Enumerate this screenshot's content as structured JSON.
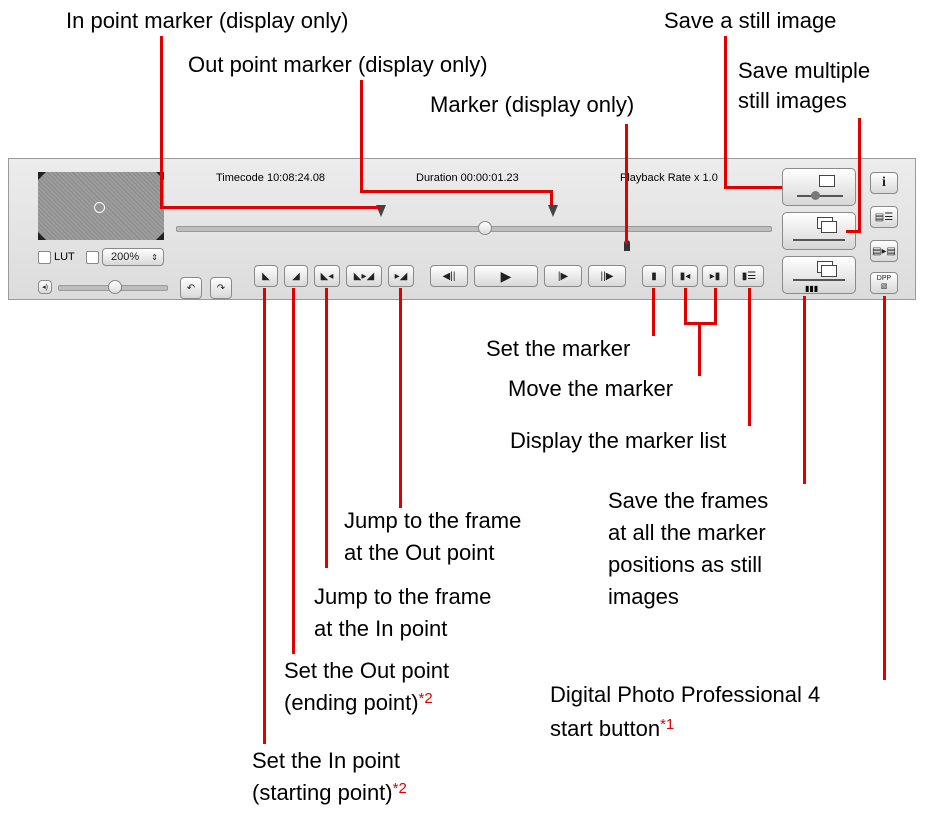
{
  "callouts": {
    "in_marker": "In point marker (display only)",
    "out_marker": "Out point marker (display only)",
    "marker": "Marker (display only)",
    "save_still": "Save a still image",
    "save_multi_1": "Save multiple",
    "save_multi_2": "still images",
    "set_marker": "Set the marker",
    "move_marker": "Move the marker",
    "display_list": "Display the marker list",
    "save_frames_1": "Save the frames",
    "save_frames_2": "at all the marker",
    "save_frames_3": "positions as still",
    "save_frames_4": "images",
    "jump_out_1": "Jump to the frame",
    "jump_out_2": "at the Out point",
    "jump_in_1": "Jump to the frame",
    "jump_in_2": "at the In point",
    "set_out_1": "Set the Out point",
    "set_out_2": "(ending point)",
    "set_out_sup": "*2",
    "dpp_1": "Digital Photo Professional 4",
    "dpp_2": "start button",
    "dpp_sup": "*1",
    "set_in_1": "Set the In point",
    "set_in_2": "(starting point)",
    "set_in_sup": "*2"
  },
  "player": {
    "timecode": "Timecode 10:08:24.08",
    "duration": "Duration 00:00:01.23",
    "playback_rate": "Playback Rate x 1.0",
    "lut_label": "LUT",
    "zoom_value": "200%",
    "info_button": "i",
    "dpp_button": "DPP"
  },
  "colors": {
    "callout_line": "#e00000",
    "sup": "#e00000"
  }
}
